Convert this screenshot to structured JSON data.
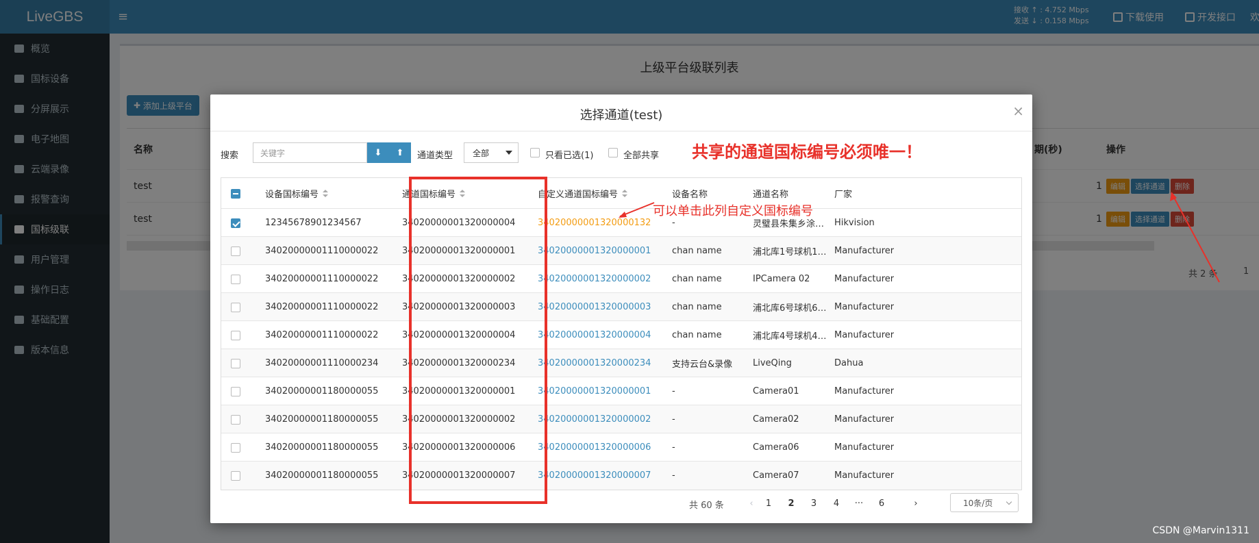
{
  "app": {
    "brand": "LiveGBS",
    "net_rx": "接收 ↑ : 4.752 Mbps",
    "net_tx": "发送 ↓ : 0.158 Mbps",
    "download_label": "下载使用",
    "dev_api_label": "开发接口",
    "last_top_char": "欢"
  },
  "sidebar": {
    "items": [
      {
        "label": "概览",
        "icon": "dashboard-icon"
      },
      {
        "label": "国标设备",
        "icon": "video-icon"
      },
      {
        "label": "分屏展示",
        "icon": "grid-icon"
      },
      {
        "label": "电子地图",
        "icon": "map-icon"
      },
      {
        "label": "云端录像",
        "icon": "cloud-icon"
      },
      {
        "label": "报警查询",
        "icon": "bell-icon"
      },
      {
        "label": "国标级联",
        "icon": "cloud-upload-icon",
        "active": true
      },
      {
        "label": "用户管理",
        "icon": "users-icon"
      },
      {
        "label": "操作日志",
        "icon": "file-icon"
      },
      {
        "label": "基础配置",
        "icon": "gears-icon"
      },
      {
        "label": "版本信息",
        "icon": "globe-icon"
      }
    ]
  },
  "background": {
    "page_title": "上级平台级联列表",
    "add_button": "添加上级平台",
    "col_name": "名称",
    "col_ops": "操作",
    "col_partial": "期(秒)",
    "rows": [
      {
        "name": "test",
        "num": "1"
      },
      {
        "name": "test",
        "num": "1"
      }
    ],
    "op_edit": "编辑",
    "op_pick": "选择通道",
    "op_delete": "删除",
    "pager_total": "共 2 条",
    "pager_page": "1"
  },
  "modal": {
    "title": "选择通道(test)",
    "close": "×",
    "search_label": "搜索",
    "search_placeholder": "关键字",
    "channel_type_label": "通道类型",
    "channel_type_value": "全部",
    "only_selected_label": "只看已选(1)",
    "share_all_label": "全部共享",
    "warning": "共享的通道国标编号必须唯一！",
    "annotation": "可以单击此列自定义国标编号",
    "columns": {
      "device_id": "设备国标编号",
      "channel_id": "通道国标编号",
      "custom_id": "自定义通道国标编号",
      "device_name": "设备名称",
      "channel_name": "通道名称",
      "vendor": "厂家"
    },
    "rows": [
      {
        "checked": true,
        "device_id": "12345678901234567",
        "channel_id": "34020000001320000004",
        "custom_id": "34020000001320000132",
        "custom_orange": true,
        "device_name": "-",
        "channel_name": "灵璧县朱集乡涂…",
        "vendor": "Hikvision"
      },
      {
        "checked": false,
        "device_id": "34020000001110000022",
        "channel_id": "34020000001320000001",
        "custom_id": "34020000001320000001",
        "device_name": "chan name",
        "channel_name": "浦北库1号球机1…",
        "vendor": "Manufacturer"
      },
      {
        "checked": false,
        "device_id": "34020000001110000022",
        "channel_id": "34020000001320000002",
        "custom_id": "34020000001320000002",
        "device_name": "chan name",
        "channel_name": "IPCamera 02",
        "vendor": "Manufacturer"
      },
      {
        "checked": false,
        "device_id": "34020000001110000022",
        "channel_id": "34020000001320000003",
        "custom_id": "34020000001320000003",
        "device_name": "chan name",
        "channel_name": "浦北库6号球机6…",
        "vendor": "Manufacturer"
      },
      {
        "checked": false,
        "device_id": "34020000001110000022",
        "channel_id": "34020000001320000004",
        "custom_id": "34020000001320000004",
        "device_name": "chan name",
        "channel_name": "浦北库4号球机4…",
        "vendor": "Manufacturer"
      },
      {
        "checked": false,
        "device_id": "34020000001110000234",
        "channel_id": "34020000001320000234",
        "custom_id": "34020000001320000234",
        "device_name": "支持云台&录像",
        "channel_name": "LiveQing",
        "vendor": "Dahua"
      },
      {
        "checked": false,
        "device_id": "34020000001180000055",
        "channel_id": "34020000001320000001",
        "custom_id": "34020000001320000001",
        "device_name": "-",
        "channel_name": "Camera01",
        "vendor": "Manufacturer"
      },
      {
        "checked": false,
        "device_id": "34020000001180000055",
        "channel_id": "34020000001320000002",
        "custom_id": "34020000001320000002",
        "device_name": "-",
        "channel_name": "Camera02",
        "vendor": "Manufacturer"
      },
      {
        "checked": false,
        "device_id": "34020000001180000055",
        "channel_id": "34020000001320000006",
        "custom_id": "34020000001320000006",
        "device_name": "-",
        "channel_name": "Camera06",
        "vendor": "Manufacturer"
      },
      {
        "checked": false,
        "device_id": "34020000001180000055",
        "channel_id": "34020000001320000007",
        "custom_id": "34020000001320000007",
        "device_name": "-",
        "channel_name": "Camera07",
        "vendor": "Manufacturer"
      }
    ],
    "pager": {
      "total": "共 60 条",
      "prev": "‹",
      "pages": [
        "1",
        "2",
        "3",
        "4",
        "···",
        "6"
      ],
      "next": "›",
      "page_size": "10条/页"
    }
  },
  "watermark": "CSDN @Marvin1311",
  "colors": {
    "accent": "#3c8dbc",
    "warning_red": "#e8312a",
    "orange_link": "#f39c12"
  }
}
